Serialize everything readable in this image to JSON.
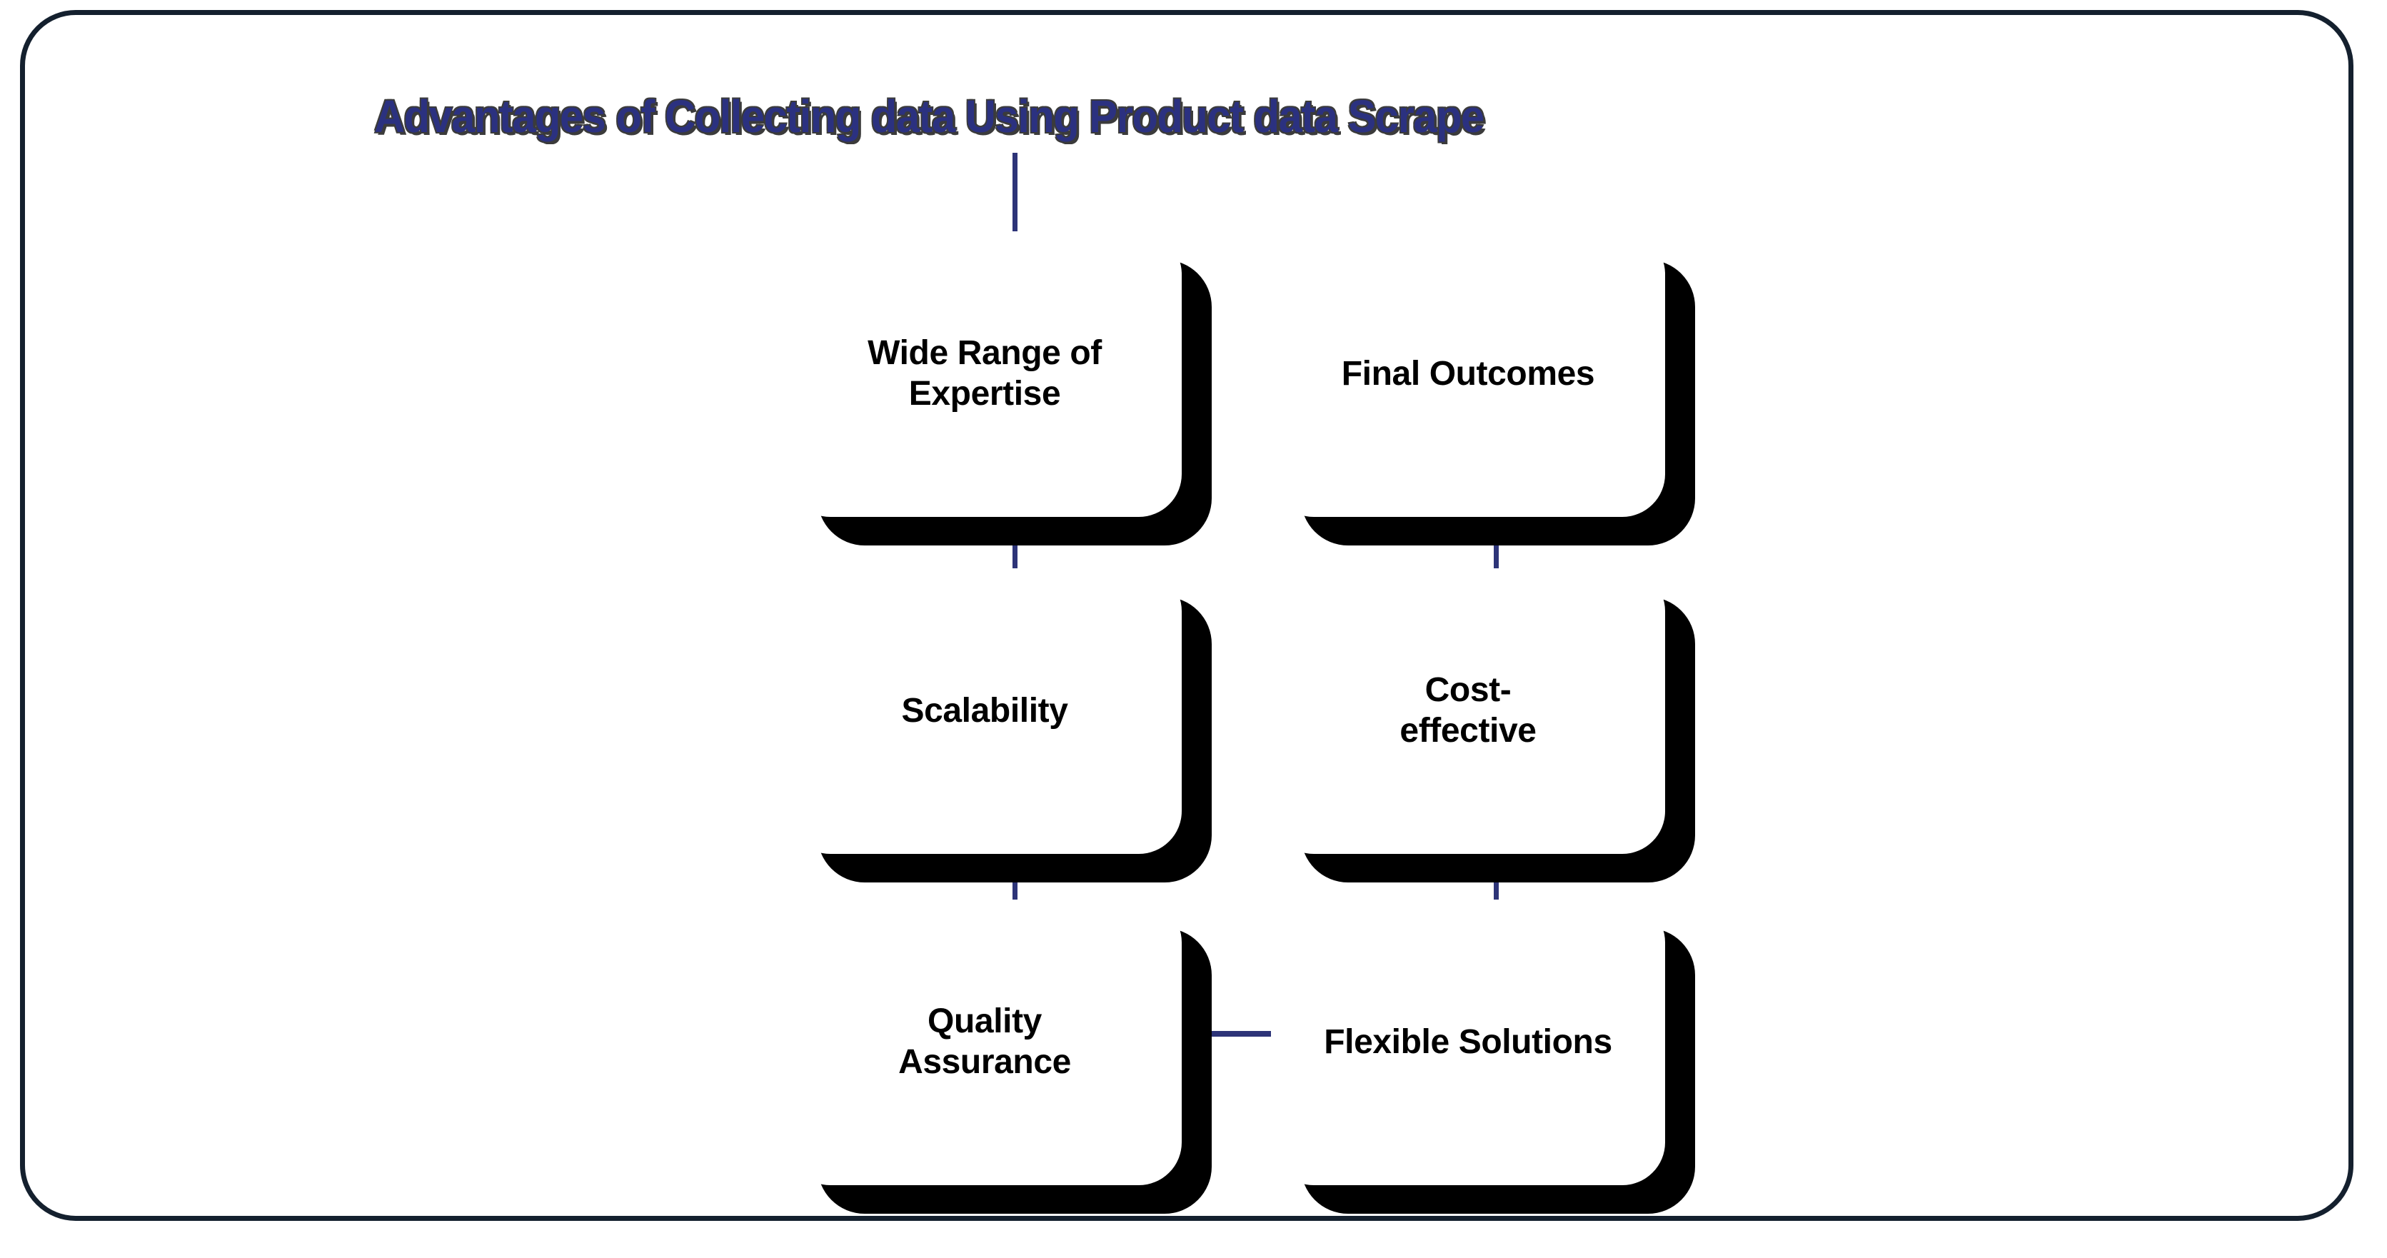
{
  "title": "Advantages of Collecting data Using Product data Scrape",
  "colors": {
    "frame_border": "#14202e",
    "title_text": "#2b3180",
    "title_shadow": "#3b3b3b",
    "connector": "#2d3478",
    "card_background": "#ffffff",
    "card_shadow": "#000000",
    "label_text": "#000000"
  },
  "nodes": [
    {
      "id": "wide-range-of-expertise",
      "label": "Wide Range of\nExpertise",
      "column": "left",
      "row": 1
    },
    {
      "id": "scalability",
      "label": "Scalability",
      "column": "left",
      "row": 2
    },
    {
      "id": "quality-assurance",
      "label": "Quality\nAssurance",
      "column": "left",
      "row": 3
    },
    {
      "id": "final-outcomes",
      "label": "Final Outcomes",
      "column": "right",
      "row": 1
    },
    {
      "id": "cost-effective",
      "label": "Cost-\neffective",
      "column": "right",
      "row": 2
    },
    {
      "id": "flexible-solutions",
      "label": "Flexible Solutions",
      "column": "right",
      "row": 3
    }
  ],
  "connectors": [
    {
      "id": "title-to-wide-range-of-expertise",
      "orientation": "vertical",
      "from": "title",
      "to": "wide-range-of-expertise"
    },
    {
      "id": "wide-range-of-expertise-to-scalability",
      "orientation": "vertical",
      "from": "wide-range-of-expertise",
      "to": "scalability"
    },
    {
      "id": "scalability-to-quality-assurance",
      "orientation": "vertical",
      "from": "scalability",
      "to": "quality-assurance"
    },
    {
      "id": "quality-assurance-to-flexible-solutions",
      "orientation": "horizontal",
      "from": "quality-assurance",
      "to": "flexible-solutions"
    },
    {
      "id": "flexible-solutions-to-cost-effective",
      "orientation": "vertical",
      "from": "flexible-solutions",
      "to": "cost-effective"
    },
    {
      "id": "cost-effective-to-final-outcomes",
      "orientation": "vertical",
      "from": "cost-effective",
      "to": "final-outcomes"
    }
  ]
}
